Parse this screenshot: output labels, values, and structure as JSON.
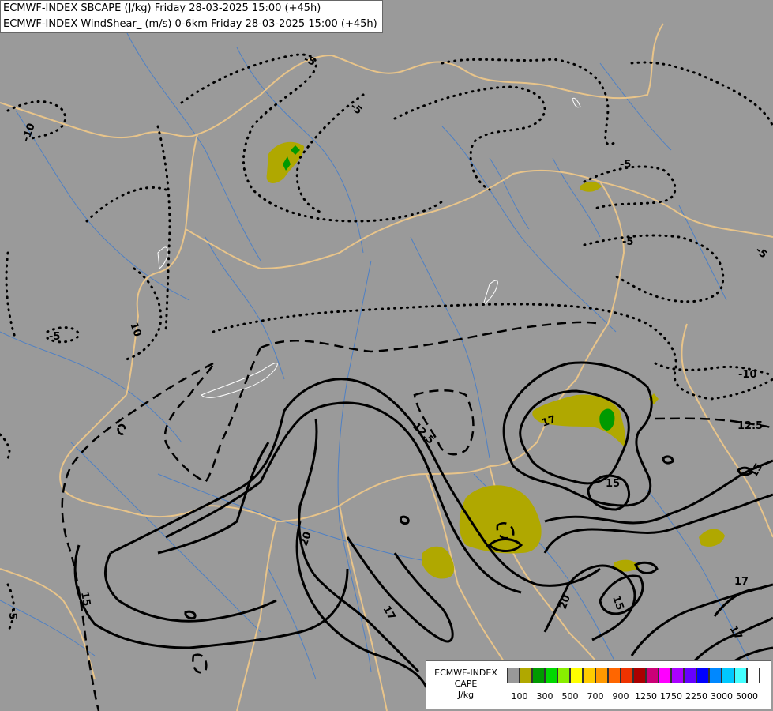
{
  "header": {
    "line1": "ECMWF-INDEX SBCAPE (J/kg) Friday 28-03-2025 15:00 (+45h)",
    "line2": "ECMWF-INDEX WindShear_ (m/s) 0-6km Friday 28-03-2025 15:00 (+45h)"
  },
  "legend": {
    "title1": "ECMWF-INDEX",
    "title2": "CAPE",
    "unit": "J/kg",
    "colors": [
      "#999999",
      "#b0a800",
      "#009a00",
      "#00d800",
      "#88ee00",
      "#ffff00",
      "#ffcc00",
      "#ff9900",
      "#ff6600",
      "#ee3300",
      "#aa0000",
      "#cc0077",
      "#ff00ff",
      "#aa00ff",
      "#6600ff",
      "#0000ff",
      "#0088ff",
      "#00c8ff",
      "#44ffff",
      "#ffffff"
    ],
    "ticks": [
      "100",
      "300",
      "500",
      "700",
      "900",
      "1250",
      "1750",
      "2250",
      "3000",
      "5000"
    ]
  },
  "contour_labels": [
    "-5",
    "-5",
    "-5",
    "-5",
    "-5",
    "-10",
    "-10",
    "-5",
    "-5",
    "12.5",
    "12.5",
    "10",
    "17",
    "15",
    "20",
    "20",
    "15",
    "17",
    "17",
    "17",
    "15",
    "-5",
    "15",
    "10"
  ],
  "colors": {
    "background": "#9a9a9a",
    "border": "#e8c48a",
    "river": "#4a7fc0",
    "cape_low": "#b0a800",
    "cape_mid": "#009a00",
    "cape_high": "#00d800"
  }
}
